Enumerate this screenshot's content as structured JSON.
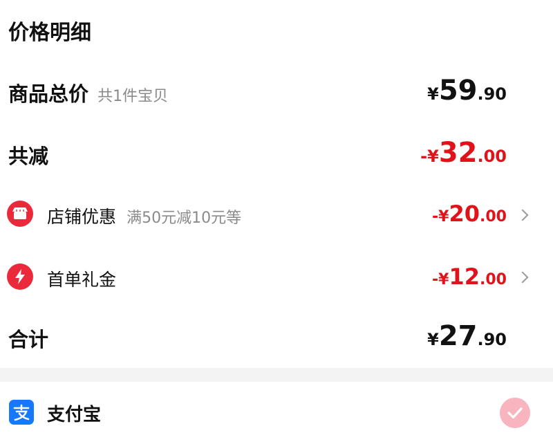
{
  "header": {
    "title": "价格明细"
  },
  "total_price": {
    "label": "商品总价",
    "sub": "共1件宝贝",
    "yen": "¥",
    "int": "59",
    "dec": ".90"
  },
  "discount_total": {
    "label": "共减",
    "yen": "-¥",
    "int": "32",
    "dec": ".00"
  },
  "discounts": [
    {
      "label": "店铺优惠",
      "sub": "满50元减10元等",
      "yen": "-¥",
      "int": "20",
      "dec": ".00",
      "icon": "shop-icon"
    },
    {
      "label": "首单礼金",
      "sub": "",
      "yen": "-¥",
      "int": "12",
      "dec": ".00",
      "icon": "lightning-icon"
    }
  ],
  "sum": {
    "label": "合计",
    "yen": "¥",
    "int": "27",
    "dec": ".90"
  },
  "payment": {
    "method": "支付宝",
    "icon": "alipay-icon",
    "selected": true
  },
  "colors": {
    "accent_red": "#e0131a",
    "icon_red": "#ea2a3b",
    "alipay_blue": "#1677ff",
    "check_pink": "#f8b5bf"
  }
}
